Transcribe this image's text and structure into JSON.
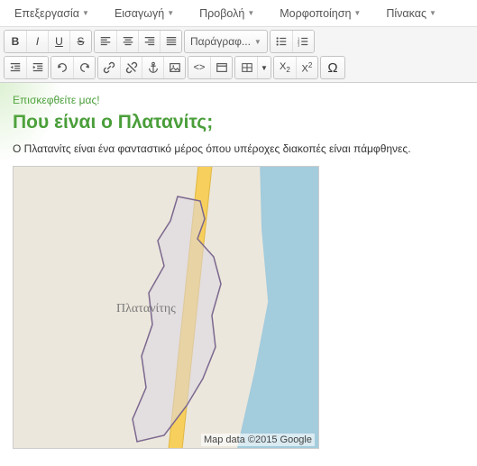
{
  "menus": {
    "edit": "Επεξεργασία",
    "insert": "Εισαγωγή",
    "view": "Προβολή",
    "format": "Μορφοποίηση",
    "table": "Πίνακας"
  },
  "toolbar": {
    "format_dropdown": "Παράγραφ...",
    "omega": "Ω"
  },
  "content": {
    "subtitle": "Επισκεφθείτε μας!",
    "heading": "Που είναι ο Πλατανίτς;",
    "paragraph": "Ο Πλατανίτς είναι ένα φανταστικό μέρος όπου υπέροχες διακοπές είναι πάμφθηνες.",
    "map_label": "Πλατανίτης",
    "map_attribution": "Map data ©2015 Google"
  }
}
